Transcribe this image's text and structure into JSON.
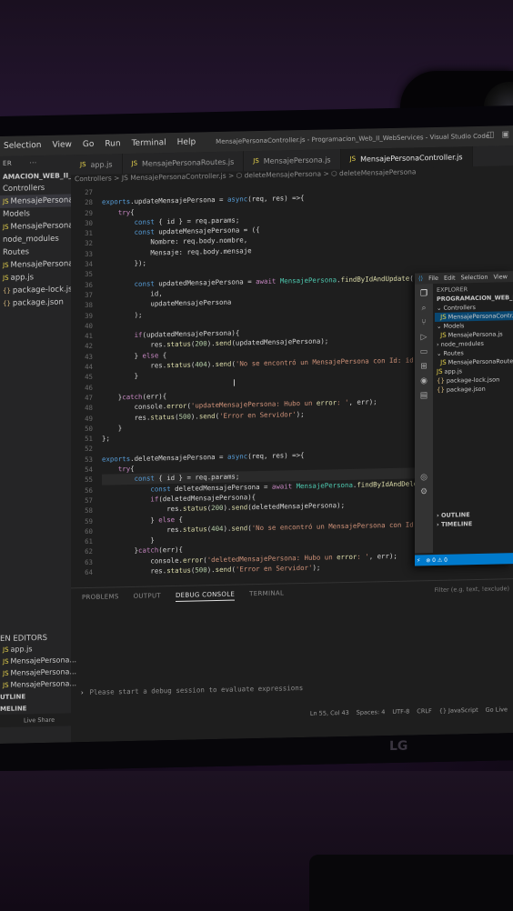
{
  "window": {
    "title": "MensajePersonaController.js - Programacion_Web_II_WebServices - Visual Studio Code",
    "menu": [
      "Selection",
      "View",
      "Go",
      "Run",
      "Terminal",
      "Help"
    ]
  },
  "monitor": {
    "brand": "LG"
  },
  "tabs": [
    {
      "label": "app.js",
      "active": false
    },
    {
      "label": "MensajePersonaRoutes.js",
      "active": false
    },
    {
      "label": "MensajePersona.js",
      "active": false
    },
    {
      "label": "MensajePersonaController.js",
      "active": true
    }
  ],
  "breadcrumb": "Controllers > JS MensajePersonaController.js > ⬡ deleteMensajePersona > ⬡ deleteMensajePersona",
  "sidebar": {
    "header": "ER",
    "project": "AMACION_WEB_II_...",
    "items": [
      {
        "label": "Controllers",
        "kind": "folder",
        "selected": false
      },
      {
        "label": "MensajePersona...",
        "kind": "js",
        "selected": true
      },
      {
        "label": "Models",
        "kind": "folder",
        "selected": false
      },
      {
        "label": "MensajePersona.js",
        "kind": "js",
        "selected": false
      },
      {
        "label": "node_modules",
        "kind": "folder",
        "selected": false
      },
      {
        "label": "Routes",
        "kind": "folder",
        "selected": false
      },
      {
        "label": "MensajePersona...",
        "kind": "js",
        "selected": false
      },
      {
        "label": "app.js",
        "kind": "js",
        "selected": false
      },
      {
        "label": "package-lock.json",
        "kind": "json",
        "selected": false
      },
      {
        "label": "package.json",
        "kind": "json",
        "selected": false
      }
    ],
    "open_editors_header": "EN EDITORS",
    "open_editors": [
      "app.js",
      "MensajePersona...",
      "MensajePersona...",
      "MensajePersona..."
    ],
    "outline": "UTLINE",
    "timeline": "MELINE"
  },
  "editor": {
    "line_numbers": [
      "27",
      "28",
      "29",
      "30",
      "31",
      "32",
      "33",
      "34",
      "35",
      "36",
      "37",
      "38",
      "39",
      "40",
      "41",
      "42",
      "43",
      "44",
      "45",
      "46",
      "47",
      "48",
      "49",
      "50",
      "51",
      "52",
      "53",
      "54",
      "55",
      "56",
      "57",
      "58",
      "59",
      "60",
      "61",
      "62",
      "63",
      "64"
    ],
    "lines": [
      "",
      "exports.updateMensajePersona = async(req, res) =>{",
      "    try{",
      "        const { id } = req.params;",
      "        const updateMensajePersona = ({",
      "            Nombre: req.body.nombre,",
      "            Mensaje: req.body.mensaje",
      "        });",
      "",
      "        const updatedMensajePersona = await MensajePersona.findByIdAndUpdate(",
      "            id,",
      "            updateMensajePersona",
      "        );",
      "",
      "        if(updatedMensajePersona){",
      "            res.status(200).send(updatedMensajePersona);",
      "        } else {",
      "            res.status(404).send('No se encontró un MensajePersona con Id: id');",
      "        }",
      "",
      "    }catch(err){",
      "        console.error('updateMensajePersona: Hubo un error: ', err);",
      "        res.status(500).send('Error en Servidor');",
      "    }",
      "};",
      "",
      "exports.deleteMensajePersona = async(req, res) =>{",
      "    try{",
      "        const { id } = req.params;",
      "            const deletedMensajePersona = await MensajePersona.findByIdAndDelete(id",
      "            if(deletedMensajePersona){",
      "                res.status(200).send(deletedMensajePersona);",
      "            } else {",
      "                res.status(404).send('No se encontró un MensajePersona con Id: id'",
      "            }",
      "        }catch(err){",
      "            console.error('deletedMensajePersona: Hubo un error: ', err);",
      "            res.status(500).send('Error en Servidor');",
      "        }"
    ]
  },
  "panel": {
    "tabs": [
      "PROBLEMS",
      "OUTPUT",
      "DEBUG CONSOLE",
      "TERMINAL"
    ],
    "active_tab": "DEBUG CONSOLE",
    "filter_placeholder": "Filter (e.g. text, !exclude)",
    "prompt_text": "Please start a debug session to evaluate expressions"
  },
  "statusbar": {
    "live_share": "Live Share",
    "position": "Ln 55, Col 43",
    "spaces": "Spaces: 4",
    "encoding": "UTF-8",
    "eol": "CRLF",
    "language": "{} JavaScript",
    "golive": "Go Live"
  },
  "window2": {
    "menu": [
      "File",
      "Edit",
      "Selection",
      "View"
    ],
    "explorer_header": "EXPLORER",
    "project": "PROGRAMACION_WEB_II_WEBS...",
    "items": [
      {
        "label": "Controllers",
        "selected": false
      },
      {
        "label": "MensajePersonaContr...",
        "selected": true
      },
      {
        "label": "Models",
        "selected": false
      },
      {
        "label": "MensajePersona.js",
        "selected": false
      },
      {
        "label": "node_modules",
        "selected": false
      },
      {
        "label": "Routes",
        "selected": false
      },
      {
        "label": "MensajePersonaRoute...",
        "selected": false
      },
      {
        "label": "app.js",
        "selected": false
      },
      {
        "label": "package-lock.json",
        "selected": false
      },
      {
        "label": "package.json",
        "selected": false
      }
    ],
    "outline": "OUTLINE",
    "timeline": "TIMELINE",
    "status": "⊗ 0 ⚠ 0"
  }
}
